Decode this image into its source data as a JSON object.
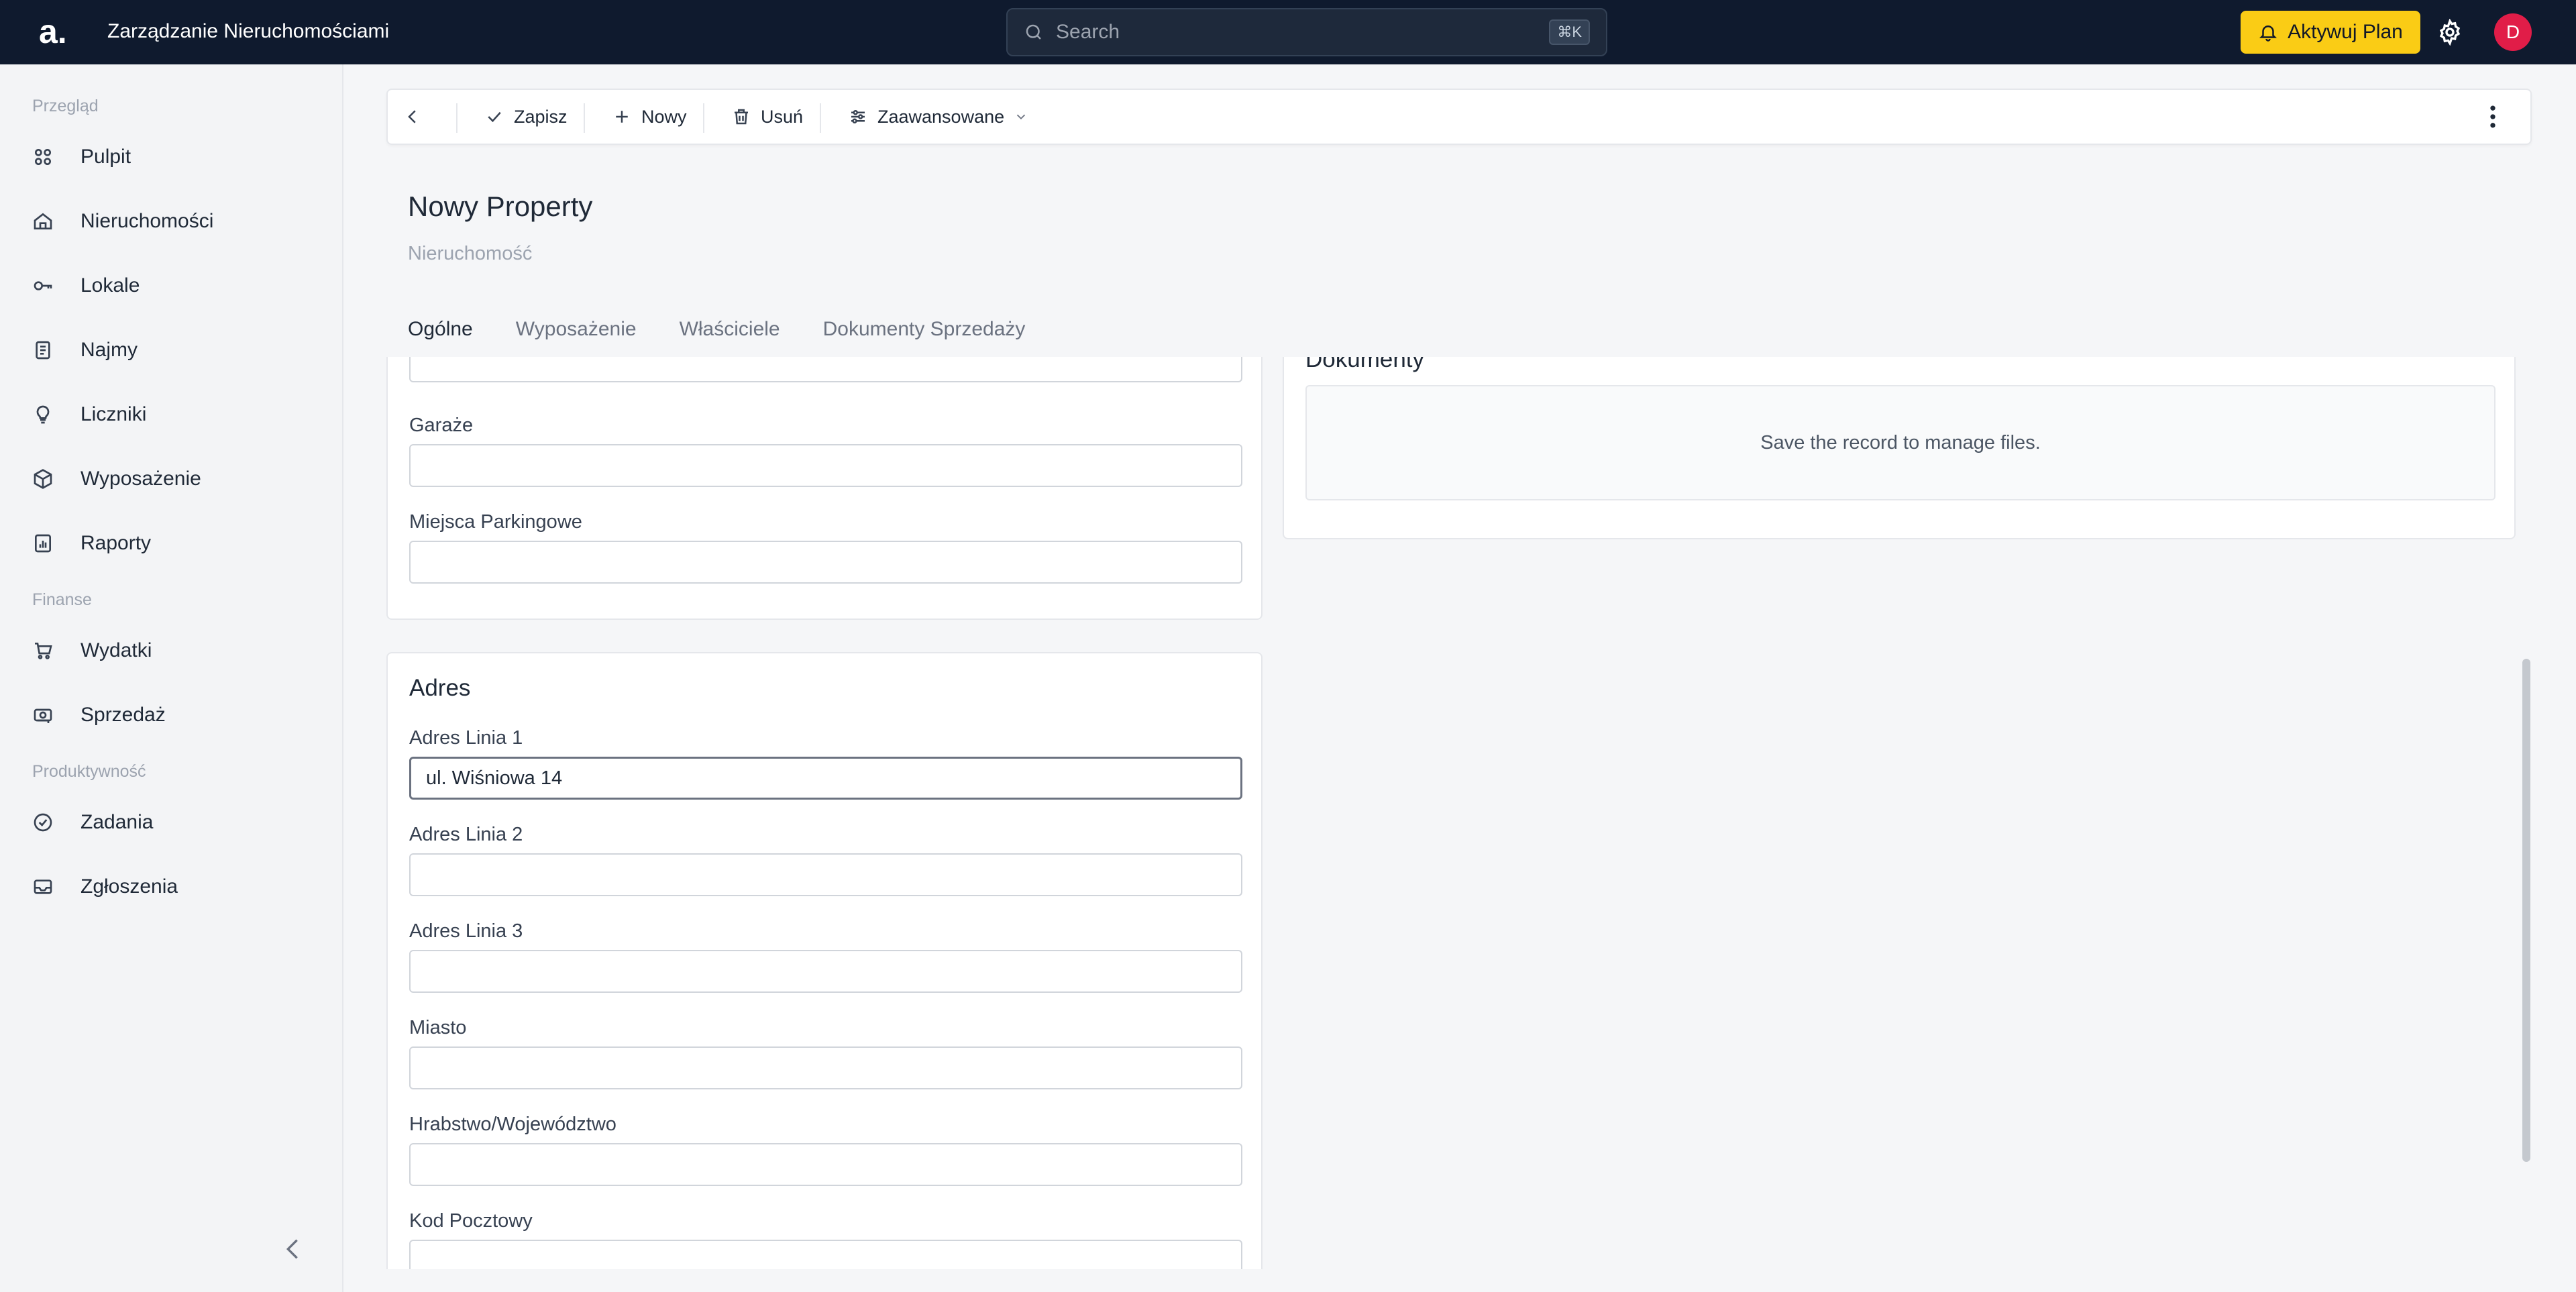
{
  "app": {
    "logo_text": "a.",
    "title": "Zarządzanie Nieruchomościami",
    "search_placeholder": "Search",
    "search_shortcut": "⌘K",
    "upgrade_label": "Aktywuj Plan",
    "avatar_initial": "D",
    "accent_color": "#facc15",
    "topbar_color": "#0f1a2e",
    "avatar_color": "#e11d48"
  },
  "sidebar": {
    "sections": [
      {
        "label": "Przegląd",
        "items": [
          {
            "label": "Pulpit",
            "icon": "grid-icon"
          },
          {
            "label": "Nieruchomości",
            "icon": "home-icon"
          },
          {
            "label": "Lokale",
            "icon": "key-icon"
          },
          {
            "label": "Najmy",
            "icon": "document-icon"
          },
          {
            "label": "Liczniki",
            "icon": "lightbulb-icon"
          },
          {
            "label": "Wyposażenie",
            "icon": "box-icon"
          },
          {
            "label": "Raporty",
            "icon": "chart-icon"
          }
        ]
      },
      {
        "label": "Finanse",
        "items": [
          {
            "label": "Wydatki",
            "icon": "cart-icon"
          },
          {
            "label": "Sprzedaż",
            "icon": "money-icon"
          }
        ]
      },
      {
        "label": "Produktywność",
        "items": [
          {
            "label": "Zadania",
            "icon": "check-circle-icon"
          },
          {
            "label": "Zgłoszenia",
            "icon": "mail-icon"
          }
        ]
      }
    ]
  },
  "toolbar": {
    "save_label": "Zapisz",
    "new_label": "Nowy",
    "delete_label": "Usuń",
    "advanced_label": "Zaawansowane"
  },
  "page": {
    "title": "Nowy Property",
    "subtitle": "Nieruchomość",
    "tabs": [
      "Ogólne",
      "Wyposażenie",
      "Właściciele",
      "Dokumenty Sprzedaży"
    ],
    "active_tab": "Ogólne"
  },
  "form": {
    "top_card": {
      "fields": [
        {
          "label": "Garaże",
          "value": ""
        },
        {
          "label": "Miejsca Parkingowe",
          "value": ""
        }
      ]
    },
    "address_card": {
      "title": "Adres",
      "fields": [
        {
          "label": "Adres Linia 1",
          "value": "ul. Wiśniowa 14"
        },
        {
          "label": "Adres Linia 2",
          "value": ""
        },
        {
          "label": "Adres Linia 3",
          "value": ""
        },
        {
          "label": "Miasto",
          "value": ""
        },
        {
          "label": "Hrabstwo/Województwo",
          "value": ""
        },
        {
          "label": "Kod Pocztowy",
          "value": ""
        }
      ]
    }
  },
  "documents": {
    "title": "Dokumenty",
    "empty_message": "Save the record to manage files."
  }
}
